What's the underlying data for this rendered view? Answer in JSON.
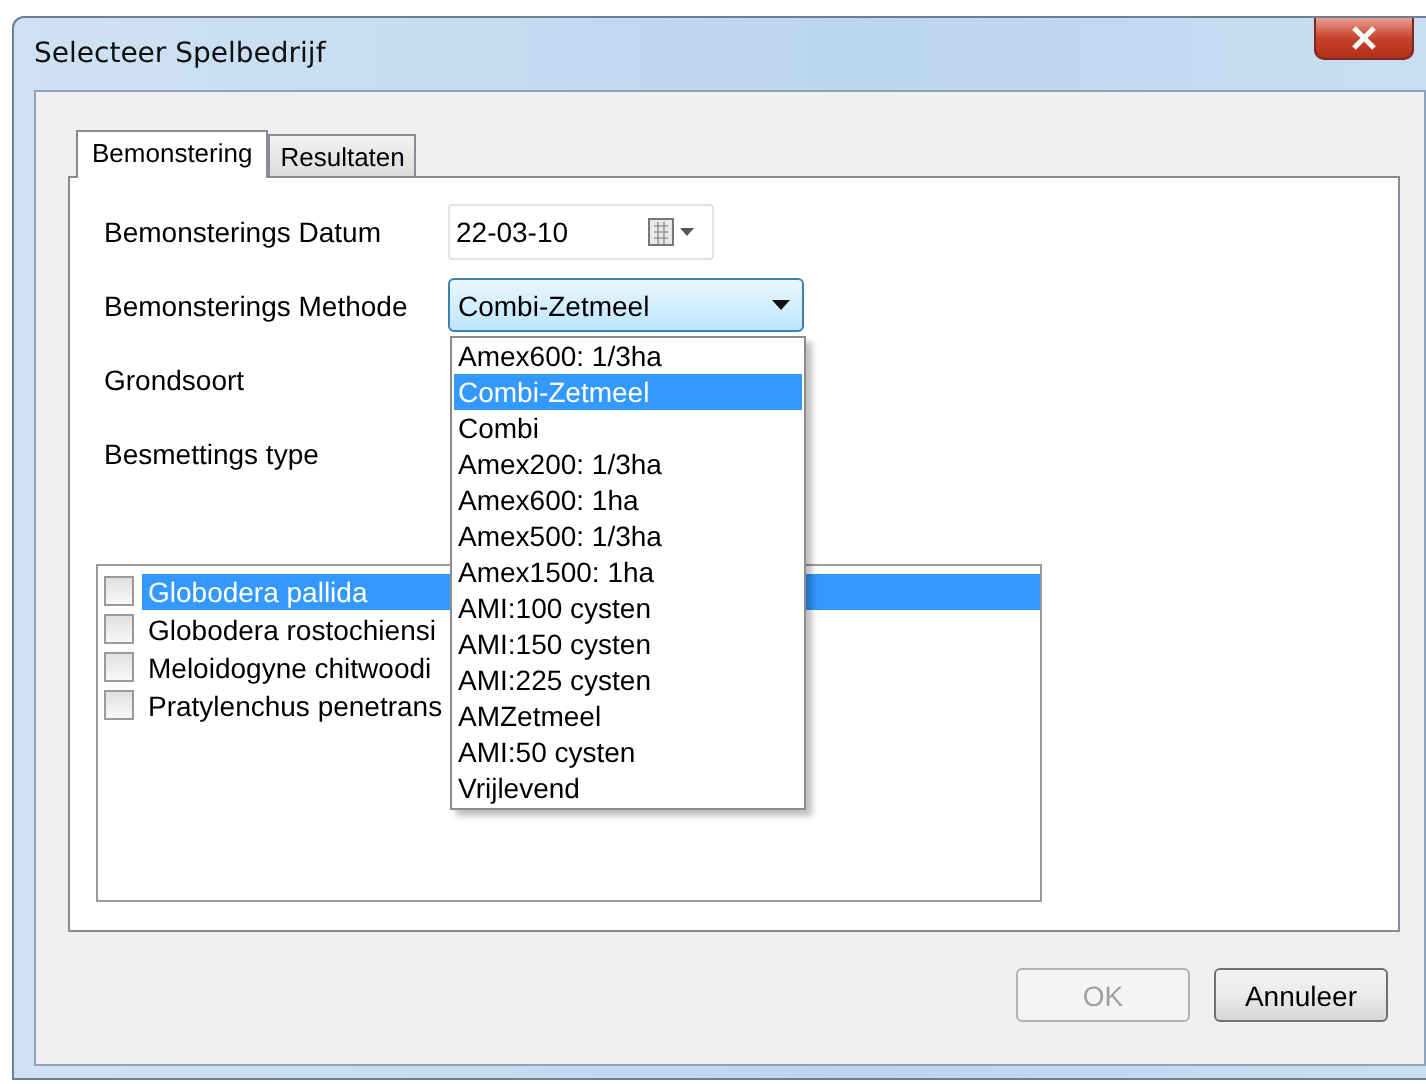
{
  "window": {
    "title": "Selecteer Spelbedrijf"
  },
  "tabs": [
    {
      "label": "Bemonstering",
      "selected": true
    },
    {
      "label": "Resultaten",
      "selected": false
    }
  ],
  "fields": [
    {
      "label": "Bemonsterings Datum",
      "kind": "date",
      "value": "22-03-10"
    },
    {
      "label": "Bemonsterings Methode",
      "kind": "combo",
      "value": "Combi-Zetmeel",
      "expanded": true,
      "options": [
        {
          "label": "Amex600: 1/3ha",
          "selected": false
        },
        {
          "label": "Combi-Zetmeel",
          "selected": true
        },
        {
          "label": "Combi",
          "selected": false
        },
        {
          "label": "Amex200: 1/3ha",
          "selected": false
        },
        {
          "label": "Amex600: 1ha",
          "selected": false
        },
        {
          "label": "Amex500: 1/3ha",
          "selected": false
        },
        {
          "label": "Amex1500: 1ha",
          "selected": false
        },
        {
          "label": "AMI:100 cysten",
          "selected": false
        },
        {
          "label": "AMI:150 cysten",
          "selected": false
        },
        {
          "label": "AMI:225 cysten",
          "selected": false
        },
        {
          "label": "AMZetmeel",
          "selected": false
        },
        {
          "label": "AMI:50 cysten",
          "selected": false
        },
        {
          "label": "Vrijlevend",
          "selected": false
        }
      ]
    },
    {
      "label": "Grondsoort",
      "kind": "label"
    },
    {
      "label": "Besmettings type",
      "kind": "label"
    }
  ],
  "species": [
    {
      "label": "Globodera pallida",
      "checked": false,
      "selected": true
    },
    {
      "label": "Globodera rostochiensi",
      "checked": false,
      "selected": false
    },
    {
      "label": "Meloidogyne chitwoodi",
      "checked": false,
      "selected": false
    },
    {
      "label": "Pratylenchus penetrans",
      "checked": false,
      "selected": false
    }
  ],
  "buttons": [
    {
      "label": "OK",
      "disabled": true
    },
    {
      "label": "Annuleer",
      "disabled": false
    }
  ]
}
